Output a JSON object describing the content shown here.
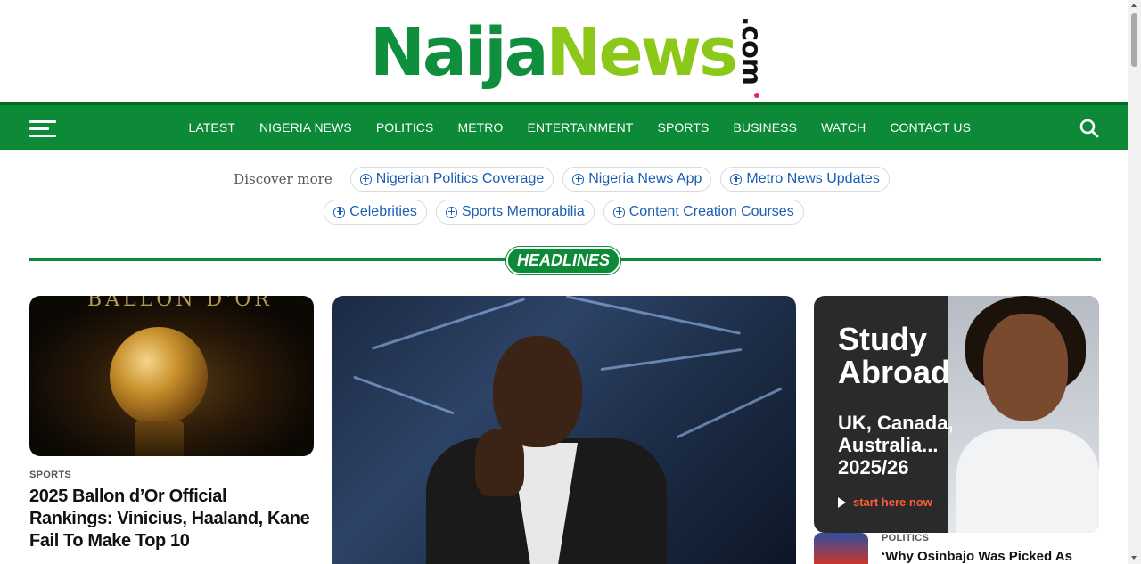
{
  "brand": {
    "logo_naija": "Naija",
    "logo_news": "News",
    "logo_com": ".com",
    "colors": {
      "primary_green": "#0c8a37",
      "lime": "#8cc81a",
      "link_blue": "#1a5fb4"
    }
  },
  "nav": {
    "menu_icon": "hamburger-icon",
    "items": [
      "LATEST",
      "NIGERIA NEWS",
      "POLITICS",
      "METRO",
      "ENTERTAINMENT",
      "SPORTS",
      "BUSINESS",
      "WATCH",
      "CONTACT US"
    ],
    "search_icon": "search-icon"
  },
  "discover": {
    "label": "Discover more",
    "chips": [
      "Nigerian Politics Coverage",
      "Nigeria News App",
      "Metro News Updates",
      "Celebrities",
      "Sports Memorabilia",
      "Content Creation Courses"
    ]
  },
  "section": {
    "title": "HEADLINES"
  },
  "cards": {
    "left": {
      "image_text": "BALLON D'OR",
      "category": "SPORTS",
      "title": "2025 Ballon d’Or Official Rankings: Vinicius, Haaland, Kane Fail To Make Top 10"
    },
    "ad": {
      "title": "Study Abroad",
      "subtitle": "UK, Canada, Australia... 2025/26",
      "cta": "start here now"
    },
    "small": {
      "category": "POLITICS",
      "title": "‘Why Osinbajo Was Picked As"
    }
  }
}
